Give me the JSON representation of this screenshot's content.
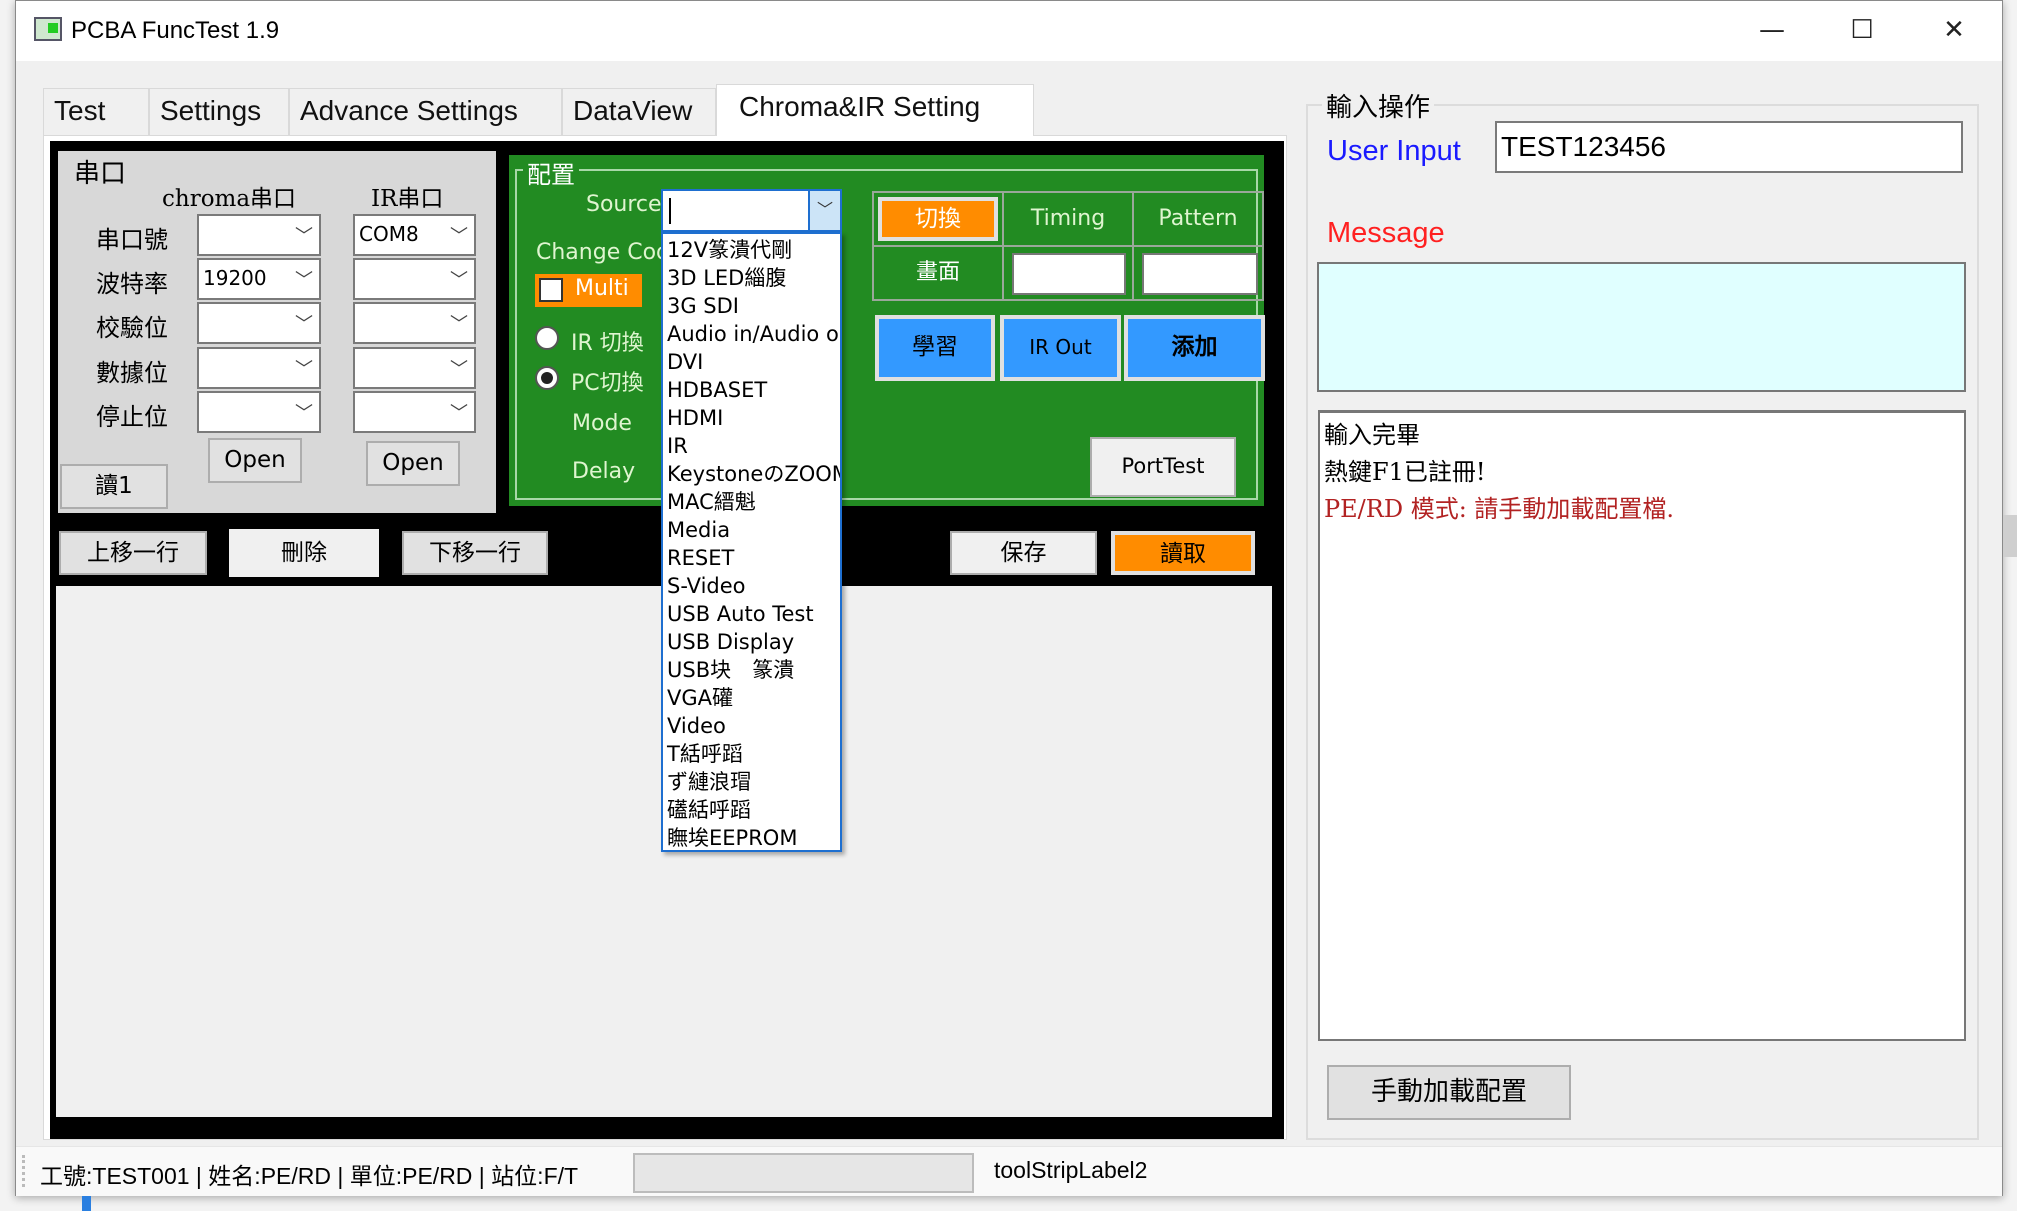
{
  "window": {
    "title": "PCBA FuncTest 1.9",
    "minimize": "—",
    "maximize": "☐",
    "close": "✕"
  },
  "tabs": [
    {
      "label": "Test"
    },
    {
      "label": "Settings"
    },
    {
      "label": "Advance Settings"
    },
    {
      "label": "DataView"
    },
    {
      "label": "Chroma&IR Setting",
      "selected": true
    }
  ],
  "serial": {
    "group": "串口",
    "chroma_header": "chroma串口",
    "ir_header": "IR串口",
    "rows": [
      {
        "label": "串口號",
        "chroma": "",
        "ir": "COM8"
      },
      {
        "label": "波特率",
        "chroma": "19200",
        "ir": ""
      },
      {
        "label": "校驗位",
        "chroma": "",
        "ir": ""
      },
      {
        "label": "數據位",
        "chroma": "",
        "ir": ""
      },
      {
        "label": "停止位",
        "chroma": "",
        "ir": ""
      }
    ],
    "open_chroma": "Open",
    "open_ir": "Open",
    "read1": "讀1"
  },
  "config": {
    "group": "配置",
    "source_label": "Source",
    "source_value": "",
    "change_code": "Change Code",
    "multi": "Multi",
    "multi_checked": false,
    "ir_switch": "IR 切換",
    "pc_switch": "PC切換",
    "selected_mode": "PC切換",
    "mode": "Mode",
    "delay": "Delay",
    "switch_btn": "切換",
    "timing": "Timing",
    "pattern": "Pattern",
    "screen": "畫面",
    "timing_value": "",
    "pattern_value": "",
    "learn": "學習",
    "ir_out": "IR Out",
    "add": "添加",
    "port_test": "PortTest",
    "source_options": [
      "12V篆潰代剛",
      "3D LED緇腹",
      "3G SDI",
      "Audio in/Audio o",
      "DVI",
      "HDBASET",
      "HDMI",
      "IR",
      "KeystoneのZOOM",
      "MAC縉魁",
      "Media",
      "RESET",
      "S-Video",
      "USB Auto Test",
      "USB Display",
      "USB块　篆潰",
      "VGA礶",
      "Video",
      "T絬呼蹈",
      "ず縺浪瑁",
      "礚絬呼蹈",
      "瞴埃EEPROM"
    ]
  },
  "actions": {
    "up": "上移一行",
    "delete": "刪除",
    "down": "下移一行",
    "save": "保存",
    "read": "讀取"
  },
  "right": {
    "group": "輸入操作",
    "user_input_label": "User Input",
    "user_input_value": "TEST123456",
    "message_label": "Message",
    "message": "",
    "log": [
      {
        "text": "輸入完畢",
        "color": "#000000"
      },
      {
        "text": "熱鍵F1已註冊!",
        "color": "#000000"
      },
      {
        "text": "PE/RD 模式: 請手動加載配置檔.",
        "color": "#b22222"
      }
    ],
    "manual_load": "手動加載配置"
  },
  "status": {
    "info": "工號:TEST001 | 姓名:PE/RD | 單位:PE/RD | 站位:F/T",
    "progress": 0,
    "label2": "toolStripLabel2"
  },
  "colors": {
    "green": "#228b22",
    "orange": "#ff8c00",
    "blue": "#3399ff",
    "cyan": "#e0ffff"
  }
}
